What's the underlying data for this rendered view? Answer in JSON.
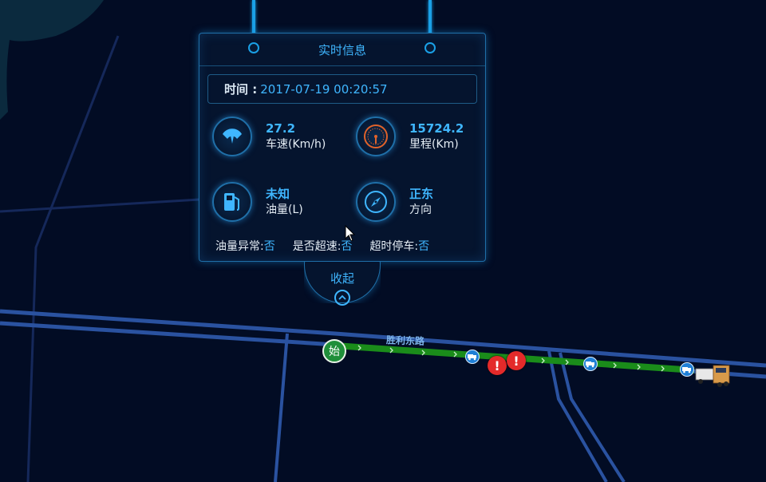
{
  "map": {
    "road_name": "胜利东路",
    "start_marker_label": "始",
    "alerts": [
      "!",
      "!"
    ]
  },
  "panel": {
    "title": "实时信息",
    "time_label": "时间 :",
    "time_value": "2017-07-19 00:20:57",
    "metrics": [
      {
        "icon": "speedometer-icon",
        "value": "27.2",
        "label": "车速(Km/h)"
      },
      {
        "icon": "odometer-icon",
        "value": "15724.2",
        "label": "里程(Km)"
      },
      {
        "icon": "fuel-pump-icon",
        "value": "未知",
        "label": "油量(L)"
      },
      {
        "icon": "compass-icon",
        "value": "正东",
        "label": "方向"
      }
    ],
    "flags": [
      {
        "label": "油量异常:",
        "value": "否"
      },
      {
        "label": "是否超速:",
        "value": "否"
      },
      {
        "label": "超时停车:",
        "value": "否"
      }
    ],
    "collapse_label": "收起"
  },
  "colors": {
    "background": "#020c24",
    "road": "#2a52a0",
    "accent": "#3fb6ff",
    "route": "#1a8c1a",
    "alert": "#e42a2a"
  }
}
